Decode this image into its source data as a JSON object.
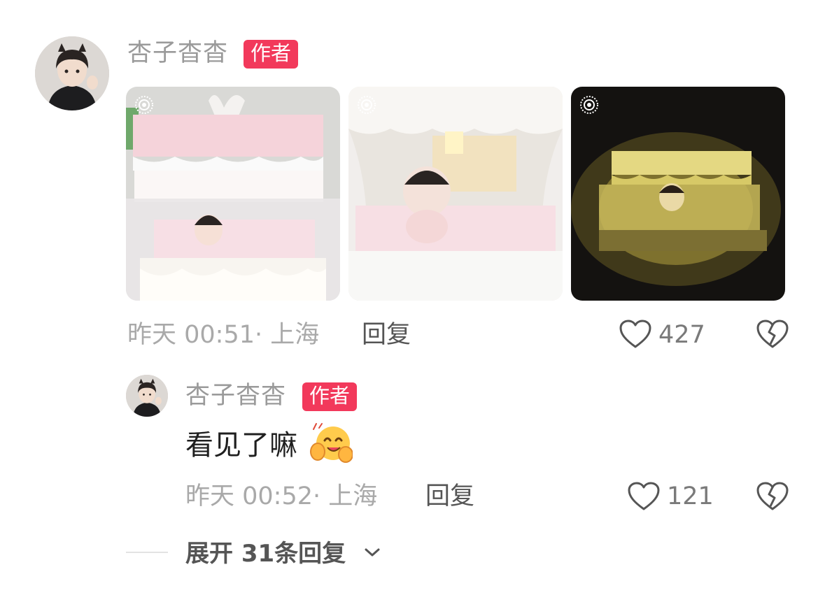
{
  "comment": {
    "username": "杏子杳杳",
    "badge": "作者",
    "time_location": "昨天 00:51· 上海",
    "reply_label": "回复",
    "like_count": "427",
    "images": [
      {
        "icon": "live-photo-icon",
        "theme": "pink-canopy-bed"
      },
      {
        "icon": "live-photo-icon",
        "theme": "canopy-bed-closeup"
      },
      {
        "icon": "live-photo-icon",
        "theme": "canopy-bed-night-light"
      }
    ]
  },
  "reply": {
    "username": "杏子杳杳",
    "badge": "作者",
    "text": "看见了嘛",
    "emoji": "hugging-face-emoji",
    "time_location": "昨天 00:52· 上海",
    "reply_label": "回复",
    "like_count": "121"
  },
  "expand": {
    "label": "展开 31条回复",
    "icon": "chevron-down-icon"
  },
  "colors": {
    "badge": "#f2395b",
    "meta_text": "#a9a9a9",
    "username": "#9a9a9a"
  }
}
